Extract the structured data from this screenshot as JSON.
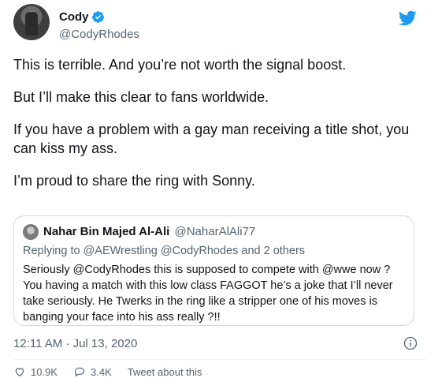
{
  "author": {
    "display_name": "Cody",
    "handle": "@CodyRhodes",
    "verified": true
  },
  "tweet": {
    "paragraphs": [
      "This is terrible. And you’re not worth the signal boost.",
      "But I’ll make this clear to fans worldwide.",
      "If you have a problem with a gay man receiving a title shot, you can kiss my ass.",
      "I’m proud to share the ring with Sonny."
    ],
    "timestamp": "12:11 AM · Jul 13, 2020"
  },
  "quoted": {
    "display_name": "Nahar Bin Majed Al-Ali",
    "handle": "@NaharAlAli77",
    "reply_line": "Replying to @AEWrestling @CodyRhodes and 2 others",
    "text": "Seriously @CodyRhodes this is supposed to compete with @wwe now  ? You having a match with this low class FAGGOT he’s a joke that I’ll never take seriously. He Twerks in the ring like a stripper one of his moves is banging your face into his ass really ?!!"
  },
  "actions": {
    "likes": "10.9K",
    "replies": "3.4K",
    "talk_label": "Tweet about this"
  },
  "colors": {
    "twitter_blue": "#1d9bf0",
    "secondary_text": "#536471"
  },
  "icons": [
    "twitter-bird-icon",
    "verified-badge-icon",
    "info-icon",
    "like-icon",
    "reply-icon"
  ]
}
